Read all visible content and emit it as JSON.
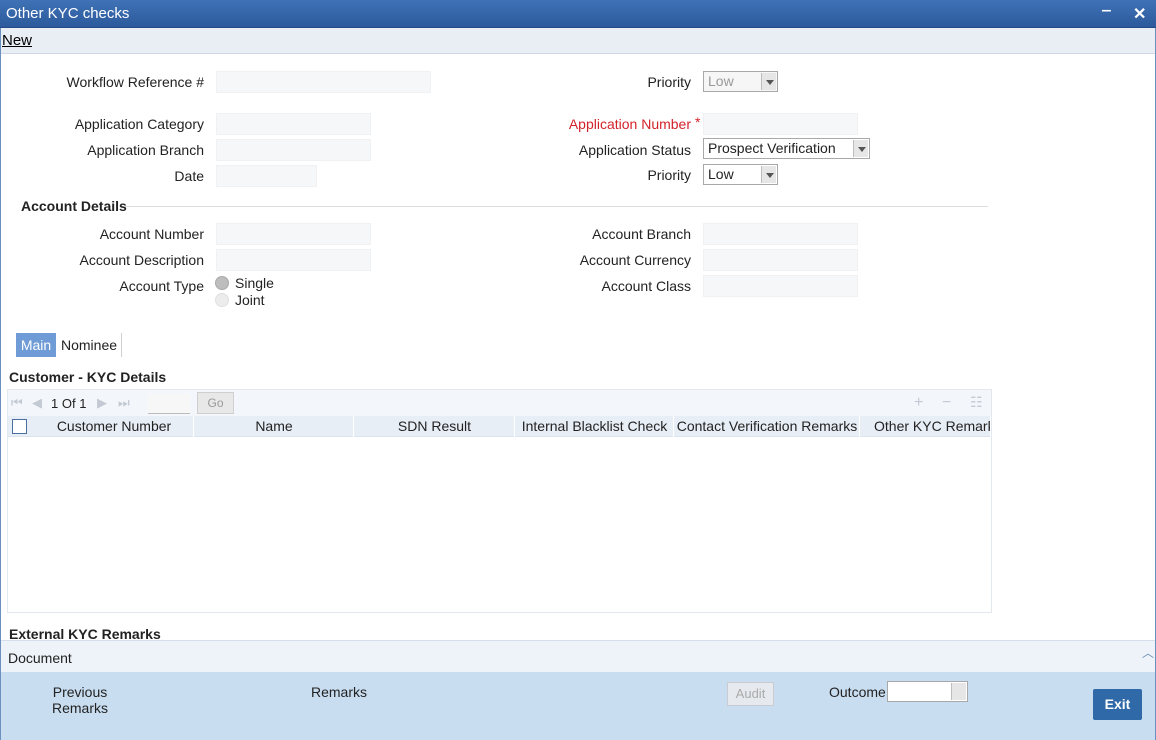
{
  "window": {
    "title": "Other KYC checks",
    "minimize": "‒",
    "close": "✕"
  },
  "toolbar": {
    "new_label": "New"
  },
  "header": {
    "workflow_ref_label": "Workflow Reference #",
    "workflow_ref_value": "",
    "priority_label": "Priority",
    "priority_value": "Low",
    "application_category_label": "Application Category",
    "application_branch_label": "Application Branch",
    "date_label": "Date",
    "application_number_label": "Application Number",
    "application_number_required": "*",
    "application_status_label": "Application Status",
    "application_status_value": "Prospect Verification",
    "priority2_label": "Priority",
    "priority2_value": "Low"
  },
  "account_details": {
    "title": "Account Details",
    "account_number_label": "Account Number",
    "account_description_label": "Account Description",
    "account_type_label": "Account Type",
    "account_type_options": [
      "Single",
      "Joint"
    ],
    "account_branch_label": "Account Branch",
    "account_currency_label": "Account Currency",
    "account_class_label": "Account Class"
  },
  "tabs": [
    {
      "label": "Main"
    },
    {
      "label": "Nominee"
    }
  ],
  "kyc_grid": {
    "title": "Customer - KYC Details",
    "pager": {
      "current": "1",
      "of_label": "Of",
      "total": "1",
      "go_label": "Go"
    },
    "columns": [
      "Customer Number",
      "Name",
      "SDN Result",
      "Internal Blacklist Check",
      "Contact Verification Remarks",
      "Other KYC Remarks"
    ]
  },
  "external_kyc": {
    "title": "External KYC Remarks"
  },
  "document_bar": {
    "label": "Document"
  },
  "footer": {
    "previous_remarks_line1": "Previous",
    "previous_remarks_line2": "Remarks",
    "remarks_label": "Remarks",
    "audit_label": "Audit",
    "outcome_label": "Outcome",
    "exit_label": "Exit"
  }
}
